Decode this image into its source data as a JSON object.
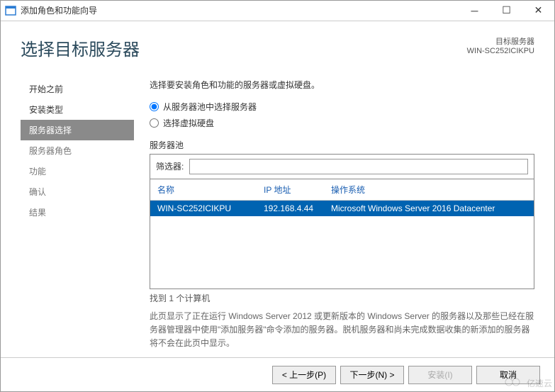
{
  "titlebar": {
    "title": "添加角色和功能向导"
  },
  "header": {
    "page_title": "选择目标服务器",
    "right_line1": "目标服务器",
    "right_line2": "WIN-SC252ICIKPU"
  },
  "sidebar": {
    "items": [
      {
        "label": "开始之前",
        "state": "past"
      },
      {
        "label": "安装类型",
        "state": "past"
      },
      {
        "label": "服务器选择",
        "state": "active"
      },
      {
        "label": "服务器角色",
        "state": "future"
      },
      {
        "label": "功能",
        "state": "future"
      },
      {
        "label": "确认",
        "state": "future"
      },
      {
        "label": "结果",
        "state": "future"
      }
    ]
  },
  "main": {
    "instruction": "选择要安装角色和功能的服务器或虚拟硬盘。",
    "radio1": "从服务器池中选择服务器",
    "radio2": "选择虚拟硬盘",
    "pool_label": "服务器池",
    "filter_label": "筛选器:",
    "filter_value": "",
    "columns": {
      "name": "名称",
      "ip": "IP 地址",
      "os": "操作系统"
    },
    "rows": [
      {
        "name": "WIN-SC252ICIKPU",
        "ip": "192.168.4.44",
        "os": "Microsoft Windows Server 2016 Datacenter"
      }
    ],
    "count": "找到 1 个计算机",
    "description": "此页显示了正在运行 Windows Server 2012 或更新版本的 Windows Server 的服务器以及那些已经在服务器管理器中使用\"添加服务器\"命令添加的服务器。脱机服务器和尚未完成数据收集的新添加的服务器将不会在此页中显示。"
  },
  "footer": {
    "prev": "< 上一步(P)",
    "next": "下一步(N) >",
    "install": "安装(I)",
    "cancel": "取消"
  },
  "watermark": "亿速云"
}
